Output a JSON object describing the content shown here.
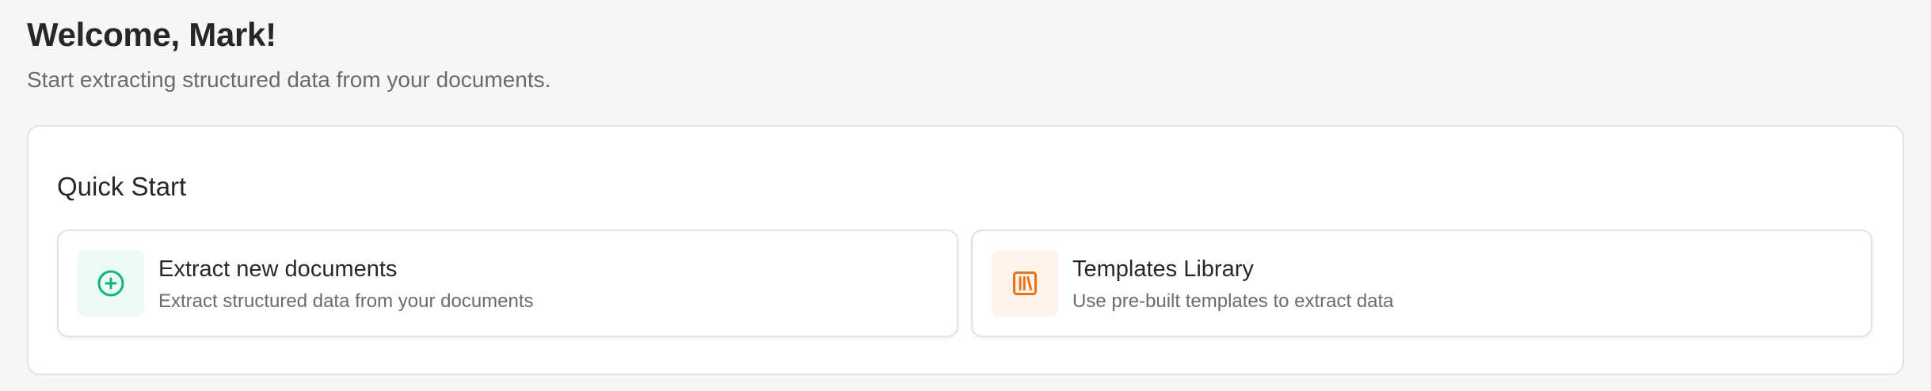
{
  "header": {
    "title": "Welcome, Mark!",
    "subtitle": "Start extracting structured data from your documents."
  },
  "quick_start": {
    "title": "Quick Start",
    "cards": [
      {
        "title": "Extract new documents",
        "description": "Extract structured data from your documents",
        "icon": "plus-circle-icon",
        "accent": "#10b27f",
        "icon_bg": "#ebfbf4"
      },
      {
        "title": "Templates Library",
        "description": "Use pre-built templates to extract data",
        "icon": "library-icon",
        "accent": "#e8751a",
        "icon_bg": "#fff3ea"
      }
    ]
  }
}
